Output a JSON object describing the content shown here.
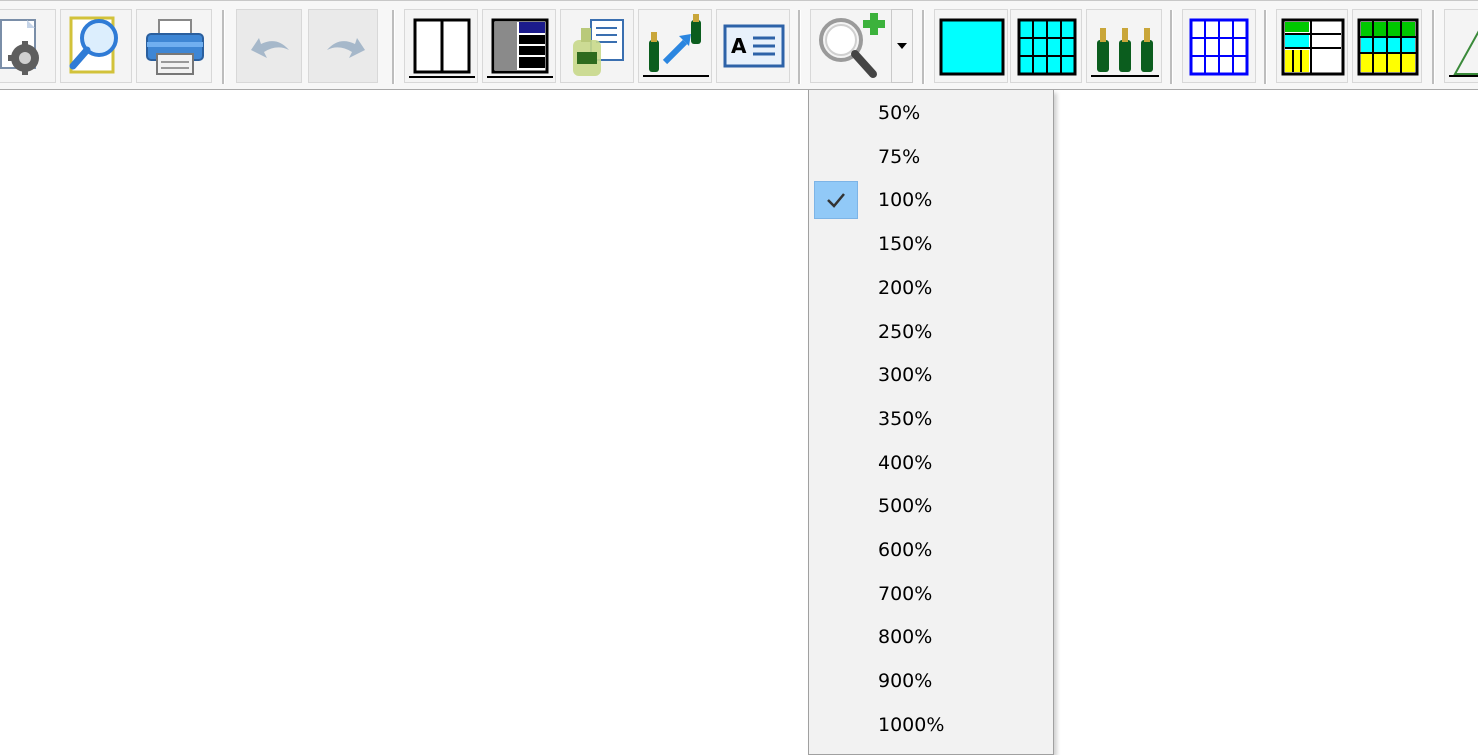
{
  "toolbar": {
    "buttons": [
      {
        "name": "page-setup-button",
        "icon": "page-setup-gear-icon",
        "enabled": true
      },
      {
        "name": "print-preview-button",
        "icon": "magnifier-page-icon",
        "enabled": true
      },
      {
        "name": "print-button",
        "icon": "printer-icon",
        "enabled": true
      },
      {
        "name": "undo-button",
        "icon": "undo-arrow-icon",
        "enabled": false
      },
      {
        "name": "redo-button",
        "icon": "redo-arrow-icon",
        "enabled": false
      },
      {
        "name": "two-column-layout-button",
        "icon": "two-panel-icon",
        "enabled": true
      },
      {
        "name": "list-layout-button",
        "icon": "grid-list-icon",
        "enabled": true
      },
      {
        "name": "bottle-details-button",
        "icon": "bottle-document-icon",
        "enabled": true
      },
      {
        "name": "move-bottle-button",
        "icon": "bottle-move-icon",
        "enabled": true
      },
      {
        "name": "text-label-button",
        "icon": "text-label-icon",
        "enabled": true
      },
      {
        "name": "zoom-button",
        "icon": "zoom-in-icon",
        "enabled": true
      },
      {
        "name": "single-cell-button",
        "icon": "cyan-box-icon",
        "enabled": true
      },
      {
        "name": "cell-grid-button",
        "icon": "cyan-grid-icon",
        "enabled": true
      },
      {
        "name": "bottles-view-button",
        "icon": "three-bottles-icon",
        "enabled": true
      },
      {
        "name": "grid-outline-button",
        "icon": "blue-grid-icon",
        "enabled": true
      },
      {
        "name": "rack-layout-button",
        "icon": "rack-color-icon",
        "enabled": true
      },
      {
        "name": "rack-grid-button",
        "icon": "rack-grid-icon",
        "enabled": true
      },
      {
        "name": "triangle-tool-button",
        "icon": "triangle-icon",
        "enabled": true
      }
    ],
    "colors": {
      "cyan": "#00ffff",
      "blue": "#0000ff",
      "yellow": "#ffff00",
      "green": "#00c800",
      "bottle_green": "#0b5d1e"
    }
  },
  "zoom_menu": {
    "selected": "100%",
    "check_color": "#91c9f7",
    "items": [
      "50%",
      "75%",
      "100%",
      "150%",
      "200%",
      "250%",
      "300%",
      "350%",
      "400%",
      "500%",
      "600%",
      "700%",
      "800%",
      "900%",
      "1000%"
    ]
  }
}
